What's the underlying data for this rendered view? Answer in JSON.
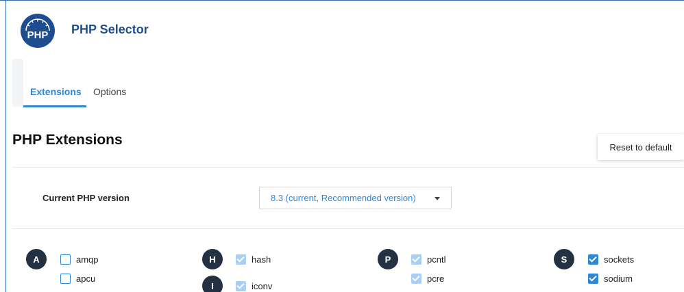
{
  "logo": {
    "text": "PHP"
  },
  "app": {
    "title": "PHP Selector"
  },
  "tabs": [
    {
      "label": "Extensions",
      "active": true
    },
    {
      "label": "Options",
      "active": false
    }
  ],
  "section": {
    "title": "PHP Extensions",
    "reset_label": "Reset to default"
  },
  "version": {
    "label": "Current PHP version",
    "selected": "8.3 (current, Recommended version)"
  },
  "groups": {
    "a": {
      "letter": "A"
    },
    "h": {
      "letter": "H"
    },
    "i": {
      "letter": "I"
    },
    "p": {
      "letter": "P"
    },
    "s": {
      "letter": "S"
    }
  },
  "extensions": {
    "amqp": {
      "name": "amqp",
      "state": "unchecked"
    },
    "apcu": {
      "name": "apcu",
      "state": "unchecked"
    },
    "hash": {
      "name": "hash",
      "state": "checked-disabled"
    },
    "iconv": {
      "name": "iconv",
      "state": "checked-disabled"
    },
    "pcntl": {
      "name": "pcntl",
      "state": "checked-disabled"
    },
    "pcre": {
      "name": "pcre",
      "state": "checked-disabled"
    },
    "sockets": {
      "name": "sockets",
      "state": "checked"
    },
    "sodium": {
      "name": "sodium",
      "state": "checked"
    }
  },
  "colors": {
    "accent": "#2e86d6",
    "title_blue": "#1f4e8c",
    "badge": "#243142",
    "disabled_check": "#a9cff3"
  }
}
